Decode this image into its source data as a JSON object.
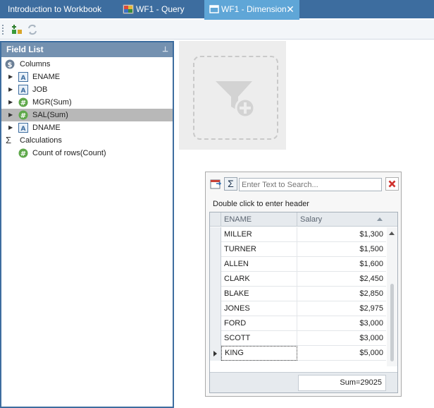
{
  "tabs": [
    {
      "label": "Introduction to Workbook",
      "icon": "none",
      "active": false
    },
    {
      "label": "WF1 - Query",
      "icon": "query-icon",
      "active": false
    },
    {
      "label": "WF1 - Dimension",
      "icon": "window-icon",
      "active": true
    }
  ],
  "toolbar": {
    "buttons": [
      "add-field-icon",
      "refresh-icon"
    ]
  },
  "field_list": {
    "title": "Field List",
    "groups": [
      {
        "label": "Columns",
        "icon": "dollar-icon"
      },
      {
        "label": "Calculations",
        "icon": "sigma-icon"
      }
    ],
    "fields": [
      {
        "label": "ENAME",
        "icon": "text-field-icon"
      },
      {
        "label": "JOB",
        "icon": "text-field-icon"
      },
      {
        "label": "MGR(Sum)",
        "icon": "number-field-icon"
      },
      {
        "label": "SAL(Sum)",
        "icon": "number-field-icon",
        "selected": true
      },
      {
        "label": "DNAME",
        "icon": "text-field-icon"
      }
    ],
    "calculations": [
      {
        "label": "Count of rows(Count)",
        "icon": "number-field-icon"
      }
    ]
  },
  "filter_card": {
    "icon": "add-filter-icon"
  },
  "grid": {
    "search_placeholder": "Enter Text to Search...",
    "header_caption": "Double click to enter header",
    "columns": [
      "ENAME",
      "Salary"
    ],
    "sort": {
      "column": "Salary",
      "direction": "ascending"
    },
    "rows": [
      {
        "ename": "MILLER",
        "salary": "$1,300"
      },
      {
        "ename": "TURNER",
        "salary": "$1,500"
      },
      {
        "ename": "ALLEN",
        "salary": "$1,600"
      },
      {
        "ename": "CLARK",
        "salary": "$2,450"
      },
      {
        "ename": "BLAKE",
        "salary": "$2,850"
      },
      {
        "ename": "JONES",
        "salary": "$2,975"
      },
      {
        "ename": "FORD",
        "salary": "$3,000"
      },
      {
        "ename": "SCOTT",
        "salary": "$3,000"
      },
      {
        "ename": "KING",
        "salary": "$5,000",
        "current": true
      }
    ],
    "footer_sum": "Sum=29025"
  },
  "colors": {
    "tabbar": "#3d6d9f",
    "active_tab": "#5fa6d7",
    "panel_header": "#7491b0",
    "selection": "#b8b8b8"
  }
}
